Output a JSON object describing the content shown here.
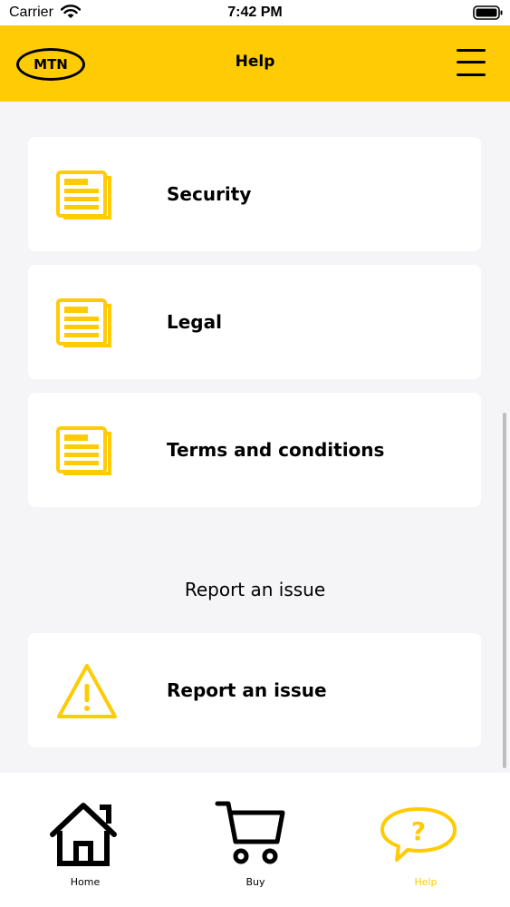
{
  "status_bar": {
    "carrier": "Carrier",
    "time": "7:42 PM"
  },
  "header": {
    "logo_text": "MTN",
    "title": "Help"
  },
  "menu_items": [
    {
      "label": "Security",
      "icon": "document-icon"
    },
    {
      "label": "Legal",
      "icon": "document-icon"
    },
    {
      "label": "Terms and conditions",
      "icon": "document-icon"
    }
  ],
  "report_section": {
    "heading": "Report an issue",
    "item_label": "Report an issue",
    "icon": "warning-icon"
  },
  "tabs": [
    {
      "label": "Home",
      "icon": "home-icon"
    },
    {
      "label": "Buy",
      "icon": "cart-icon"
    },
    {
      "label": "Help",
      "icon": "help-bubble-icon",
      "active": true
    }
  ],
  "colors": {
    "brand_yellow": "#ffcb05",
    "background": "#f5f5f7",
    "text": "#000000"
  }
}
